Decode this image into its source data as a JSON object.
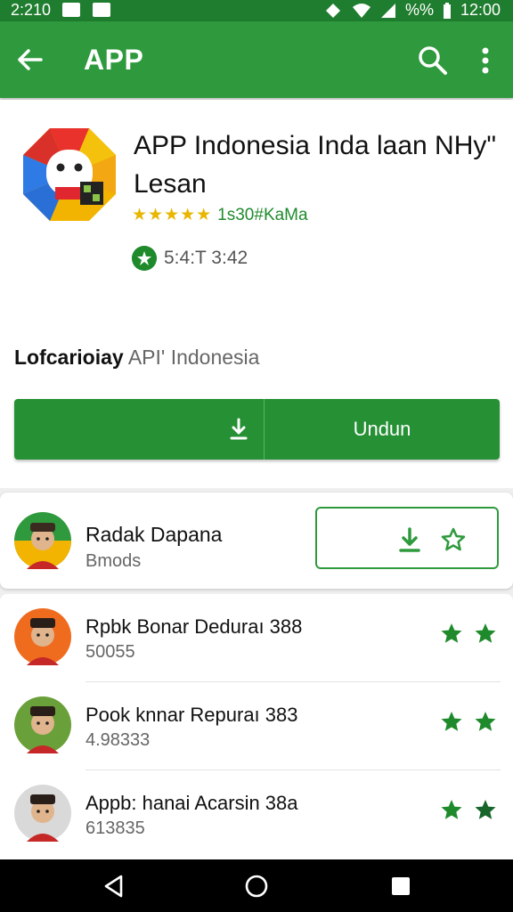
{
  "status_bar": {
    "time_left": "2:210",
    "battery": "%%",
    "time": "12:00"
  },
  "app_bar": {
    "title": "APP",
    "icons": [
      "back-arrow-icon",
      "search-icon",
      "more-vert-icon"
    ]
  },
  "app_header": {
    "name": "APP Indonesia Inda laan NHy\" Lesan",
    "rating_stars": "★★★★★",
    "rating_text": "1s30#KaMa",
    "downloads": "5:4:T 3:42",
    "developer_bold": "Lofcarioiay",
    "developer_name": "API' Indonesia",
    "install_label": "Undun"
  },
  "featured": {
    "name": "Radak Dapana",
    "sub": "Bmods"
  },
  "list_items": [
    {
      "title": "Rpbk Bonar Deduraı 388",
      "sub": "50055"
    },
    {
      "title": "Pook knnar Repuraı 383",
      "sub": "4.98333"
    },
    {
      "title": "Appb: hanai Acarsin 38a",
      "sub": "613835"
    }
  ],
  "colors": {
    "app_bar": "#2e9a3d",
    "status_bar": "#1f7d2f",
    "accent_green": "#1f8a2c",
    "star_yellow": "#e8b600"
  }
}
